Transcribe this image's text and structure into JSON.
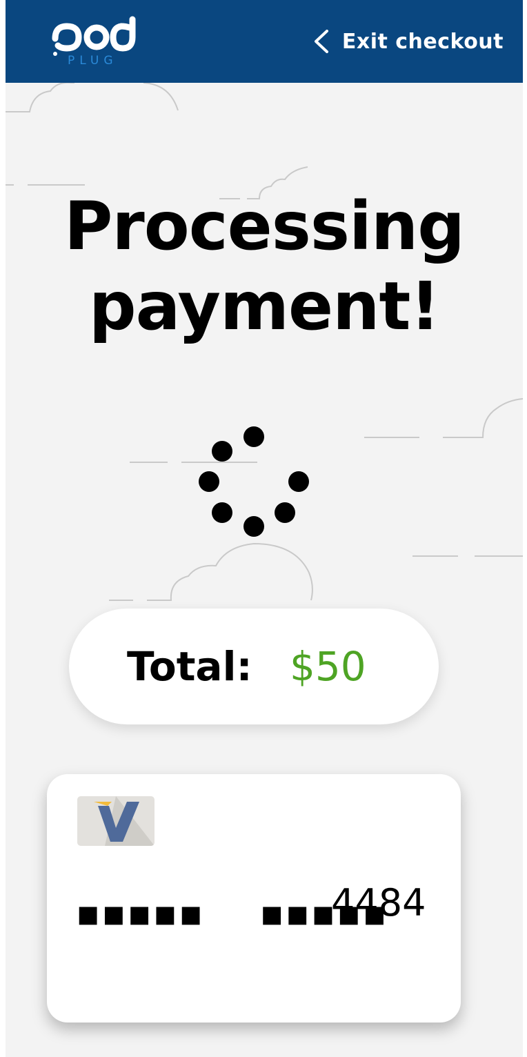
{
  "header": {
    "logo_text": "pod",
    "logo_subtext": "PLUG",
    "exit_label": "Exit checkout",
    "background_color": "#0a4780"
  },
  "main": {
    "title_line1": "Processing",
    "title_line2": "payment!",
    "spinner_icon": "loading-spinner-icon"
  },
  "total": {
    "label": "Total:",
    "value": "$50",
    "value_color": "#4ea424"
  },
  "card": {
    "brand_icon": "visa-card-icon",
    "masked_group1": "▪▪▪▪▪",
    "masked_group2": "▪▪▪▪▪",
    "last4": "4484"
  }
}
